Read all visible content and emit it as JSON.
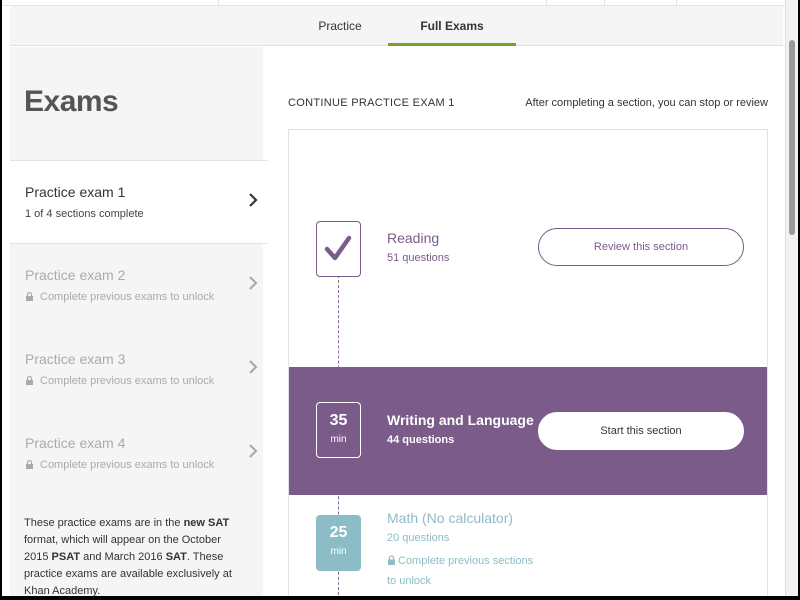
{
  "tabs": [
    {
      "label": "Practice"
    },
    {
      "label": "Full Exams"
    }
  ],
  "sidebar": {
    "title": "Exams",
    "exams": [
      {
        "title": "Practice exam 1",
        "status": "1 of 4 sections complete"
      },
      {
        "title": "Practice exam 2",
        "status": "Complete previous exams to unlock"
      },
      {
        "title": "Practice exam 3",
        "status": "Complete previous exams to unlock"
      },
      {
        "title": "Practice exam 4",
        "status": "Complete previous exams to unlock"
      }
    ],
    "note": {
      "part1": "These practice exams are in the ",
      "bold1": "new SAT",
      "part2": " format, which will appear on the October 2015 ",
      "bold2": "PSAT",
      "part3": " and March 2016 ",
      "bold3": "SAT",
      "part4": ". These practice exams are available exclusively at Khan Academy."
    }
  },
  "main": {
    "heading": "CONTINUE PRACTICE EXAM 1",
    "hint": "After completing a section, you can stop or review",
    "sections": [
      {
        "title": "Reading",
        "questions": "51 questions",
        "button": "Review this section",
        "state": "complete"
      },
      {
        "title": "Writing and Language",
        "questions": "44 questions",
        "time": "35",
        "unit": "min",
        "button": "Start this section",
        "state": "current"
      },
      {
        "title": "Math (No calculator)",
        "questions": "20 questions",
        "time": "25",
        "unit": "min",
        "lock_text": "Complete previous sections to unlock",
        "state": "locked"
      }
    ]
  },
  "colors": {
    "accent_purple": "#7b5b8a",
    "locked_teal": "#8cbcc6",
    "tab_underline": "#7a9f2a"
  }
}
